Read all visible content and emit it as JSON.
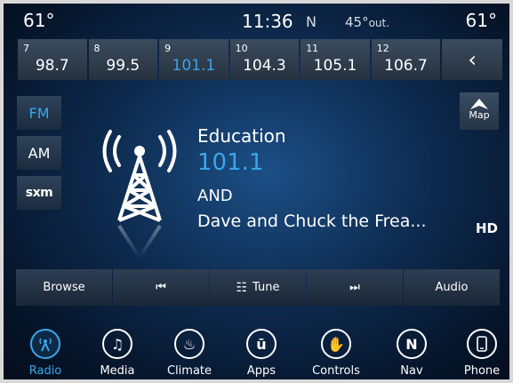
{
  "status": {
    "temp_left": "61°",
    "clock": "11:36",
    "heading": "N",
    "outside_temp": "45°",
    "outside_label": "out.",
    "temp_right": "61°"
  },
  "presets": [
    {
      "num": "7",
      "freq": "98.7"
    },
    {
      "num": "8",
      "freq": "99.5"
    },
    {
      "num": "9",
      "freq": "101.1",
      "active": true
    },
    {
      "num": "10",
      "freq": "104.3"
    },
    {
      "num": "11",
      "freq": "105.1"
    },
    {
      "num": "12",
      "freq": "106.7"
    }
  ],
  "bands": {
    "fm": "FM",
    "am": "AM",
    "sxm": "sxm"
  },
  "map_label": "Map",
  "station": {
    "genre": "Education",
    "frequency": "101.1",
    "call_sign": "AND",
    "song": "Dave and Chuck the Frea..."
  },
  "hd_label": "HD",
  "controls": {
    "browse": "Browse",
    "tune": "Tune",
    "audio": "Audio"
  },
  "nav": {
    "radio": "Radio",
    "media": "Media",
    "climate": "Climate",
    "apps": "Apps",
    "controls": "Controls",
    "nav": "Nav",
    "phone": "Phone"
  },
  "colors": {
    "accent": "#3aa6ea",
    "background": "#0d2a4e"
  }
}
